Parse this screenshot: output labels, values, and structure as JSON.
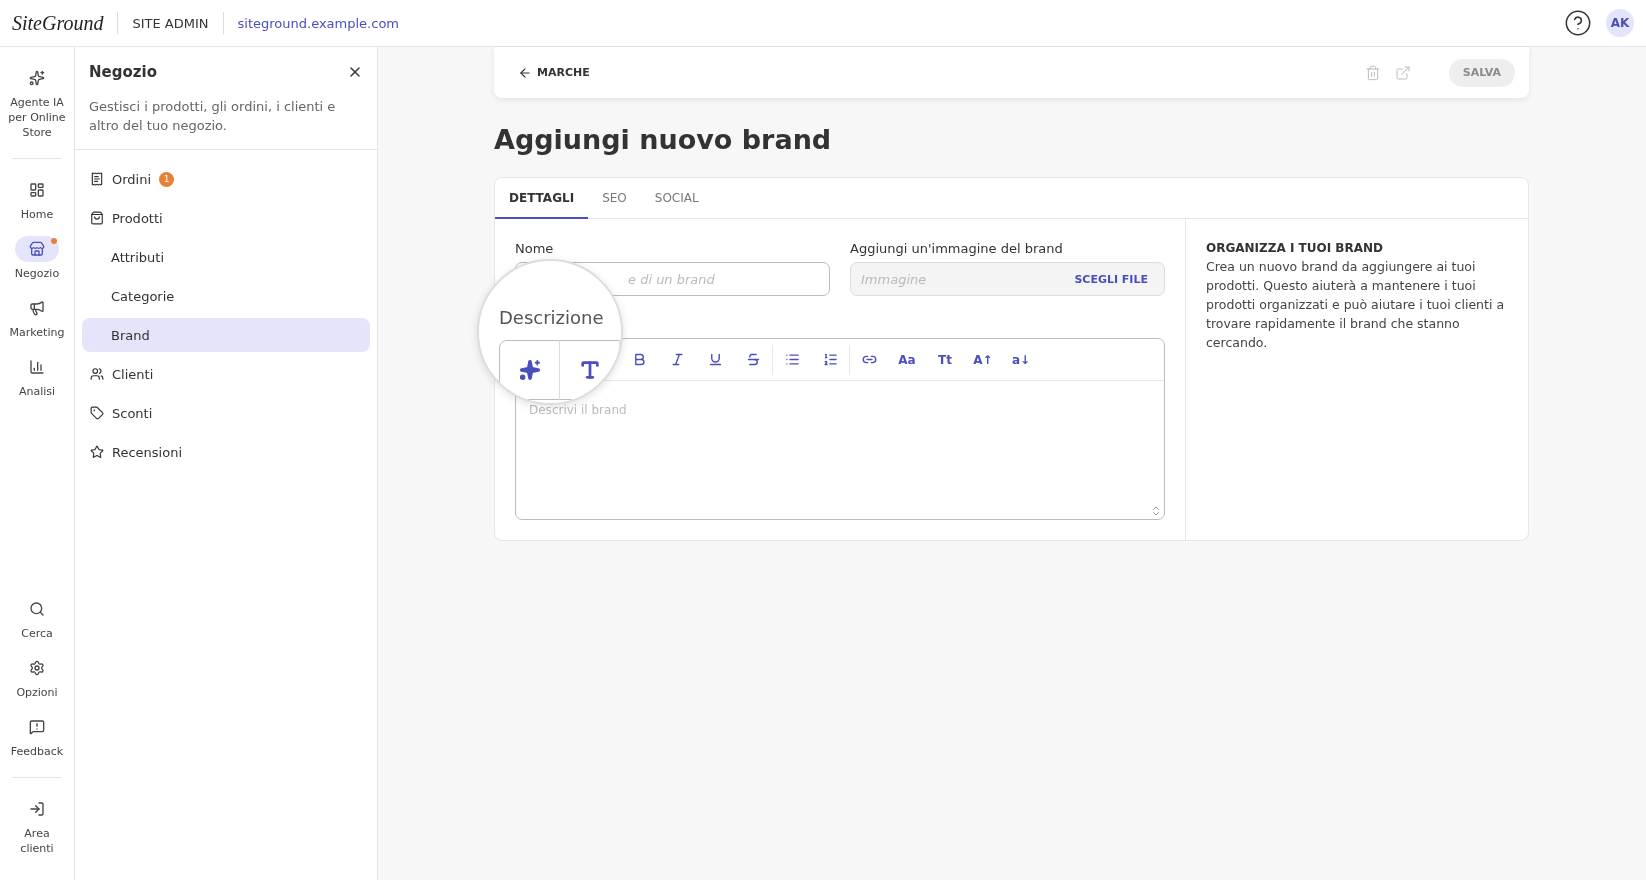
{
  "header": {
    "logo": "SiteGround",
    "section": "SITE ADMIN",
    "domain": "siteground.example.com",
    "avatar": "AK"
  },
  "rail": {
    "top": [
      {
        "label": "Agente IA per Online Store",
        "selected": false,
        "dot": false
      },
      {
        "label": "Home",
        "selected": false,
        "dot": false
      },
      {
        "label": "Negozio",
        "selected": true,
        "dot": true
      },
      {
        "label": "Marketing",
        "selected": false,
        "dot": false
      },
      {
        "label": "Analisi",
        "selected": false,
        "dot": false
      }
    ],
    "bottom": [
      {
        "label": "Cerca",
        "selected": false,
        "dot": false
      },
      {
        "label": "Opzioni",
        "selected": false,
        "dot": false
      },
      {
        "label": "Feedback",
        "selected": false,
        "dot": false
      },
      {
        "label": "Area clienti",
        "selected": false,
        "dot": false
      }
    ]
  },
  "sidebar": {
    "title": "Negozio",
    "description": "Gestisci i prodotti, gli ordini, i clienti e altro del tuo negozio.",
    "items": [
      {
        "label": "Ordini",
        "badge": "1",
        "selected": false
      },
      {
        "label": "Prodotti",
        "selected": false,
        "children": [
          {
            "label": "Attributi",
            "selected": false
          },
          {
            "label": "Categorie",
            "selected": false
          },
          {
            "label": "Brand",
            "selected": true
          }
        ]
      },
      {
        "label": "Clienti",
        "selected": false
      },
      {
        "label": "Sconti",
        "selected": false
      },
      {
        "label": "Recensioni",
        "selected": false
      }
    ]
  },
  "topbar": {
    "back": "MARCHE",
    "save": {
      "label": "SALVA",
      "disabled": true
    }
  },
  "title": "Aggiungi nuovo brand",
  "tabs": [
    {
      "label": "DETTAGLI",
      "selected": true
    },
    {
      "label": "SEO",
      "selected": false
    },
    {
      "label": "SOCIAL",
      "selected": false
    }
  ],
  "form": {
    "name": {
      "label": "Nome",
      "placeholder": "e di un brand"
    },
    "image": {
      "label": "Aggiungi un'immagine del brand",
      "placeholder": "Immagine",
      "button": "SCEGLI FILE"
    },
    "description": {
      "placeholder": "Descrivi il brand",
      "toolbar": [
        {
          "kind": "icon"
        },
        {
          "kind": "icon"
        },
        {
          "kind": "icon"
        },
        {
          "kind": "icon"
        },
        {
          "kind": "divider"
        },
        {
          "kind": "icon"
        },
        {
          "kind": "icon"
        },
        {
          "kind": "divider"
        },
        {
          "kind": "icon"
        },
        {
          "kind": "text",
          "text": "Aa"
        },
        {
          "kind": "text",
          "text": "Tt"
        },
        {
          "kind": "text",
          "text": "A↑"
        },
        {
          "kind": "text",
          "text": "a↓"
        }
      ]
    }
  },
  "magnifier": {
    "label": "Descrizione"
  },
  "info": {
    "title": "ORGANIZZA I TUOI BRAND",
    "text": "Crea un nuovo brand da aggiungere ai tuoi prodotti. Questo aiuterà a mantenere i tuoi prodotti organizzati e può aiutare i tuoi clienti a trovare rapidamente il brand che stanno cercando."
  }
}
